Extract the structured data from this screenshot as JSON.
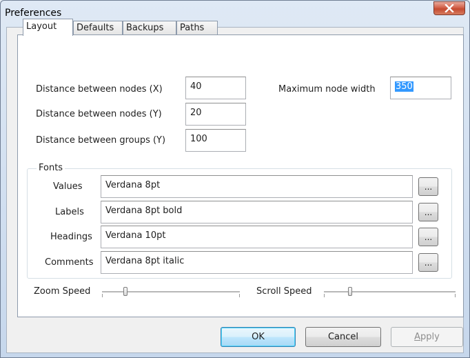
{
  "window": {
    "title": "Preferences"
  },
  "tabs": [
    {
      "label": "Layout",
      "active": true
    },
    {
      "label": "Defaults",
      "active": false
    },
    {
      "label": "Backups",
      "active": false
    },
    {
      "label": "Paths",
      "active": false
    }
  ],
  "layout": {
    "distance_x": {
      "label": "Distance between nodes (X)",
      "value": "40"
    },
    "distance_y": {
      "label": "Distance between nodes (Y)",
      "value": "20"
    },
    "distance_groups": {
      "label": "Distance between groups (Y)",
      "value": "100"
    },
    "max_node_width": {
      "label": "Maximum node width",
      "value": "350"
    }
  },
  "fonts": {
    "group_label": "Fonts",
    "rows": [
      {
        "label": "Values",
        "value": "Verdana 8pt",
        "button": "..."
      },
      {
        "label": "Labels",
        "value": "Verdana 8pt bold",
        "button": "..."
      },
      {
        "label": "Headings",
        "value": "Verdana 10pt",
        "button": "..."
      },
      {
        "label": "Comments",
        "value": "Verdana 8pt italic",
        "button": "..."
      }
    ]
  },
  "sliders": {
    "zoom": {
      "label": "Zoom Speed",
      "level": 0.17
    },
    "scroll": {
      "label": "Scroll Speed",
      "level": 0.2
    }
  },
  "buttons": {
    "ok": "OK",
    "cancel": "Cancel",
    "apply_accel": "A",
    "apply_rest": "pply"
  },
  "colors": {
    "selection": "#3399ff",
    "close": "#c44a31"
  }
}
